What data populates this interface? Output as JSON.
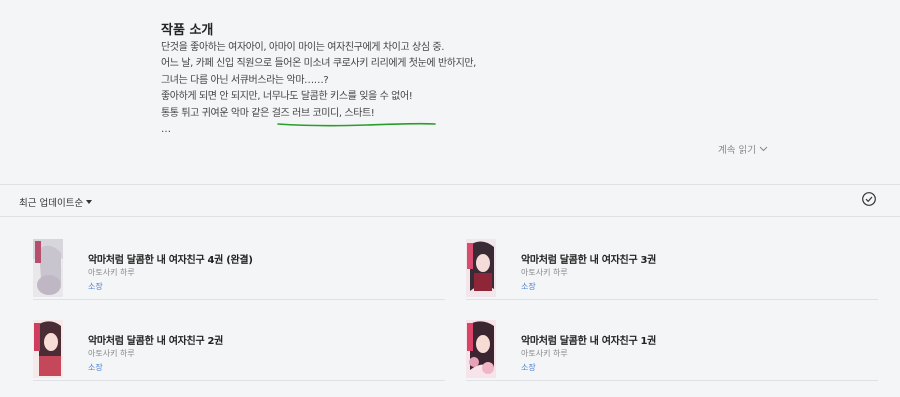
{
  "intro": {
    "title": "작품 소개",
    "lines": [
      "단것을 좋아하는 여자아이, 아마이 마이는 여자친구에게 차이고 상심 중.",
      "어느 날, 카페 신입 직원으로 들어온 미소녀 쿠로사키 리리에게 첫눈에 반하지만,",
      "그녀는 다름 아닌 서큐버스라는 악마……?",
      "좋아하게 되면 안 되지만, 너무나도 달콤한 키스를 잊을 수 없어!",
      "통통 튀고 귀여운 악마 같은 걸즈 러브 코미디, 스타트!",
      "…"
    ],
    "read_more": "계속 읽기",
    "highlight_color": "#2a9d2a"
  },
  "toolbar": {
    "sort_label": "최근 업데이트순",
    "sort_icon": "caret-down-icon",
    "select_icon": "check-circle-icon"
  },
  "volumes": [
    {
      "title": "악마처럼 달콤한 내 여자친구 4권 (완결)",
      "author": "아토사키 하루",
      "status": "소장"
    },
    {
      "title": "악마처럼 달콤한 내 여자친구 3권",
      "author": "아토사키 하루",
      "status": "소장"
    },
    {
      "title": "악마처럼 달콤한 내 여자친구 2권",
      "author": "아토사키 하루",
      "status": "소장"
    },
    {
      "title": "악마처럼 달콤한 내 여자친구 1권",
      "author": "아토사키 하루",
      "status": "소장"
    }
  ],
  "colors": {
    "link": "#4a7fd3",
    "divider": "#dfe1e4",
    "background": "#f4f5f7"
  }
}
